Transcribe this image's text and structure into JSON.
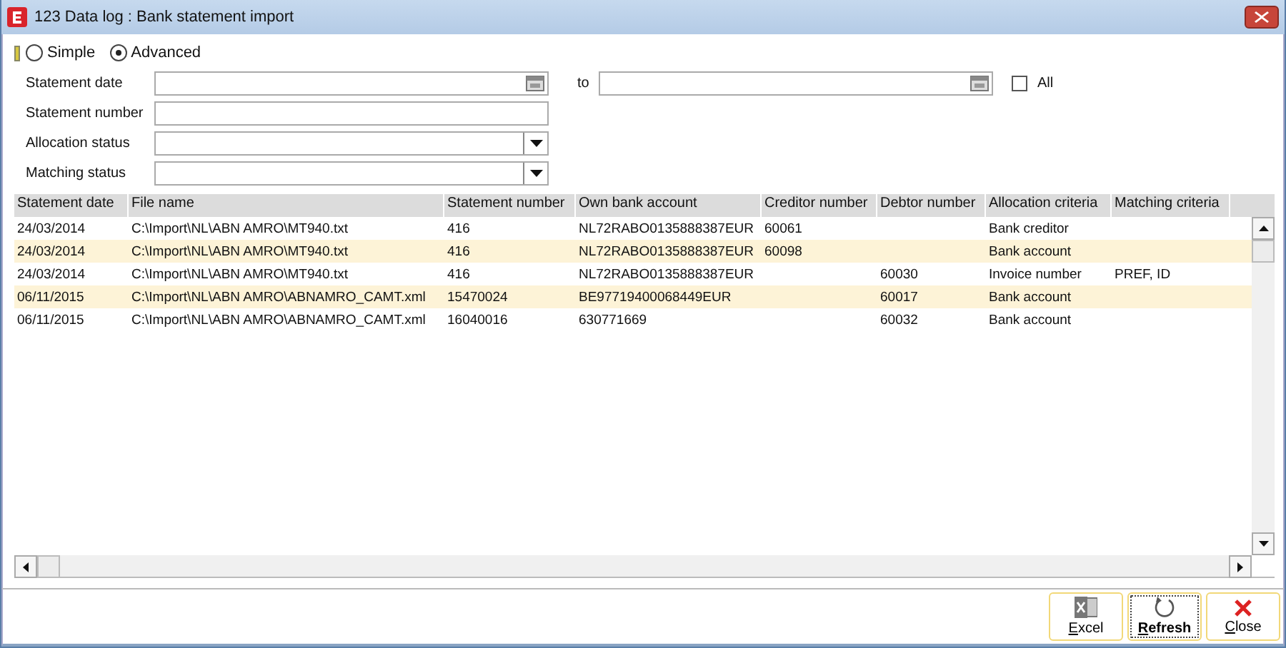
{
  "window": {
    "title": "123 Data log : Bank statement import"
  },
  "modes": [
    {
      "label": "Simple",
      "selected": false
    },
    {
      "label": "Advanced",
      "selected": true
    }
  ],
  "filters": [
    {
      "label": "Statement date",
      "kind": "date",
      "to_label": "to",
      "all_label": "All",
      "all_checked": false
    },
    {
      "label": "Statement number",
      "kind": "text"
    },
    {
      "label": "Allocation status",
      "kind": "dropdown"
    },
    {
      "label": "Matching status",
      "kind": "dropdown"
    }
  ],
  "table": {
    "columns": [
      "Statement date",
      "File name",
      "Statement number",
      "Own bank account",
      "Creditor number",
      "Debtor number",
      "Allocation criteria",
      "Matching criteria"
    ],
    "rows": [
      [
        "24/03/2014",
        "C:\\Import\\NL\\ABN AMRO\\MT940.txt",
        "416",
        "NL72RABO0135888387EUR",
        "60061",
        "",
        "Bank creditor",
        ""
      ],
      [
        "24/03/2014",
        "C:\\Import\\NL\\ABN AMRO\\MT940.txt",
        "416",
        "NL72RABO0135888387EUR",
        "60098",
        "",
        "Bank account",
        ""
      ],
      [
        "24/03/2014",
        "C:\\Import\\NL\\ABN AMRO\\MT940.txt",
        "416",
        "NL72RABO0135888387EUR",
        "",
        "60030",
        "Invoice number",
        "PREF, ID"
      ],
      [
        "06/11/2015",
        "C:\\Import\\NL\\ABN AMRO\\ABNAMRO_CAMT.xml",
        "15470024",
        "BE97719400068449EUR",
        "",
        "60017",
        "Bank account",
        ""
      ],
      [
        "06/11/2015",
        "C:\\Import\\NL\\ABN AMRO\\ABNAMRO_CAMT.xml",
        "16040016",
        "630771669",
        "",
        "60032",
        "Bank account",
        ""
      ]
    ]
  },
  "buttons": [
    {
      "label": "Excel",
      "kind": "excel",
      "focused": false
    },
    {
      "label": "Refresh",
      "kind": "refresh",
      "focused": true
    },
    {
      "label": "Close",
      "kind": "close",
      "focused": false
    }
  ]
}
